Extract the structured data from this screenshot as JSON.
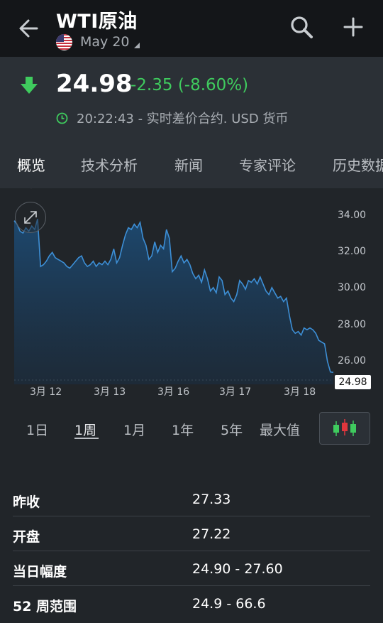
{
  "header": {
    "title": "WTI原油",
    "contract": "May 20"
  },
  "quote": {
    "price": "24.98",
    "change": "-2.35 (-8.60%)",
    "time_info": "20:22:43 - 实时差价合约. USD 货币",
    "up_color": "#3fcb5e"
  },
  "tabs": [
    "概览",
    "技术分析",
    "新闻",
    "专家评论",
    "历史数据"
  ],
  "chart_data": {
    "type": "area",
    "y_ticks": [
      "34.00",
      "32.00",
      "30.00",
      "28.00",
      "26.00"
    ],
    "x_ticks": [
      "3月 12",
      "3月 13",
      "3月 16",
      "3月 17",
      "3月 18"
    ],
    "last_price_label": "24.98",
    "ylim": [
      24.3,
      35.0
    ],
    "line_color": "#3d8fd6",
    "values": [
      33.6,
      33.4,
      33.0,
      32.9,
      33.2,
      33.0,
      33.3,
      33.1,
      33.7,
      31.0,
      31.1,
      31.3,
      31.6,
      31.8,
      31.5,
      31.4,
      31.3,
      31.2,
      31.0,
      30.9,
      31.1,
      31.3,
      31.5,
      31.6,
      31.2,
      31.0,
      31.1,
      31.3,
      31.0,
      31.2,
      31.1,
      31.3,
      31.1,
      31.4,
      32.0,
      31.2,
      31.5,
      32.2,
      32.8,
      33.2,
      33.1,
      33.4,
      33.2,
      33.5,
      32.6,
      32.2,
      31.4,
      31.6,
      32.4,
      31.8,
      32.2,
      32.0,
      33.1,
      32.6,
      30.7,
      30.9,
      31.3,
      31.6,
      31.2,
      31.4,
      31.1,
      30.6,
      30.3,
      30.5,
      30.1,
      30.8,
      30.3,
      29.6,
      29.8,
      29.5,
      30.4,
      30.2,
      29.4,
      29.6,
      29.2,
      29.0,
      29.4,
      30.2,
      30.0,
      29.7,
      30.2,
      30.1,
      30.3,
      30.0,
      30.4,
      30.0,
      29.6,
      29.4,
      29.8,
      29.5,
      29.2,
      29.3,
      29.0,
      29.2,
      28.2,
      27.4,
      27.2,
      27.3,
      27.1,
      27.5,
      27.4,
      27.5,
      27.4,
      27.2,
      26.8,
      26.7,
      26.6,
      25.6,
      25.0,
      24.98
    ]
  },
  "ranges": [
    "1日",
    "1周",
    "1月",
    "1年",
    "5年",
    "最大值"
  ],
  "stats": [
    {
      "label": "昨收",
      "value": "27.33"
    },
    {
      "label": "开盘",
      "value": "27.22"
    },
    {
      "label": "当日幅度",
      "value": "24.90 - 27.60"
    },
    {
      "label": "52 周范围",
      "value": "24.9 - 66.6"
    }
  ]
}
